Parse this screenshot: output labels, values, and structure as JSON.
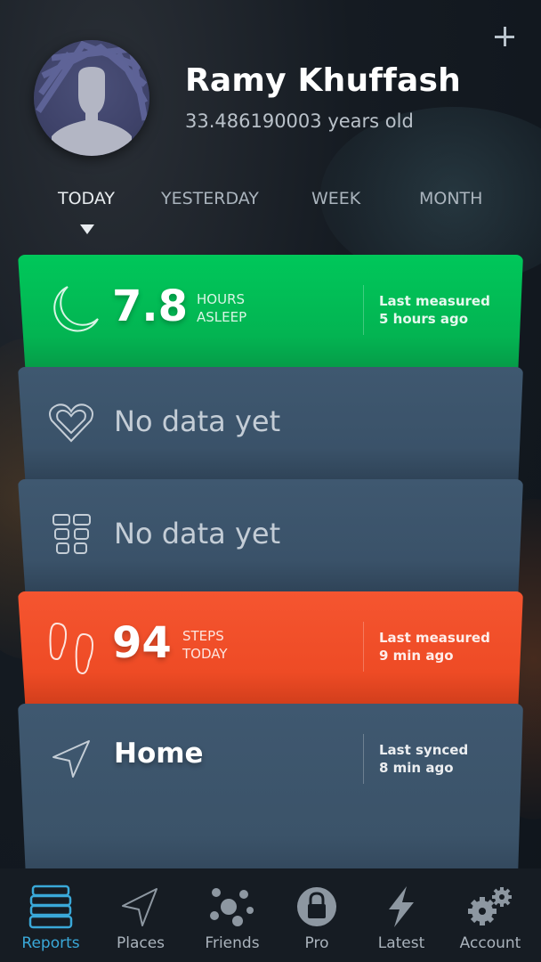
{
  "profile": {
    "name": "Ramy Khuffash",
    "age": "33.486190003 years old",
    "add_icon": "plus-icon",
    "avatar_icon": "person-silhouette-icon"
  },
  "period_tabs": [
    {
      "label": "TODAY",
      "active": true
    },
    {
      "label": "YESTERDAY",
      "active": false
    },
    {
      "label": "WEEK",
      "active": false
    },
    {
      "label": "MONTH",
      "active": false
    }
  ],
  "cards": [
    {
      "type": "sleep",
      "icon": "moon-icon",
      "value": "7.8",
      "unit_line1": "HOURS",
      "unit_line2": "ASLEEP",
      "meta_line1": "Last measured",
      "meta_line2": "5 hours ago",
      "color": "#03b452"
    },
    {
      "type": "heart",
      "icon": "heart-icon",
      "text": "No data yet",
      "color": "#3a5269"
    },
    {
      "type": "body",
      "icon": "grid-icon",
      "text": "No data yet",
      "color": "#3a5269"
    },
    {
      "type": "steps",
      "icon": "footprints-icon",
      "value": "94",
      "unit_line1": "STEPS",
      "unit_line2": "TODAY",
      "meta_line1": "Last measured",
      "meta_line2": "9 min ago",
      "color": "#ee4b25"
    },
    {
      "type": "place",
      "icon": "location-arrow-icon",
      "text": "Home",
      "meta_line1": "Last synced",
      "meta_line2": "8 min ago",
      "color": "#3a5269"
    }
  ],
  "tabbar": [
    {
      "label": "Reports",
      "icon": "stack-icon",
      "active": true
    },
    {
      "label": "Places",
      "icon": "location-arrow-icon",
      "active": false
    },
    {
      "label": "Friends",
      "icon": "friends-dots-icon",
      "active": false
    },
    {
      "label": "Pro",
      "icon": "lock-icon",
      "active": false
    },
    {
      "label": "Latest",
      "icon": "lightning-icon",
      "active": false
    },
    {
      "label": "Account",
      "icon": "gears-icon",
      "active": false
    }
  ],
  "colors": {
    "accent": "#3aa8d8",
    "sleep": "#03b452",
    "steps": "#ee4b25",
    "card": "#3a5269"
  }
}
